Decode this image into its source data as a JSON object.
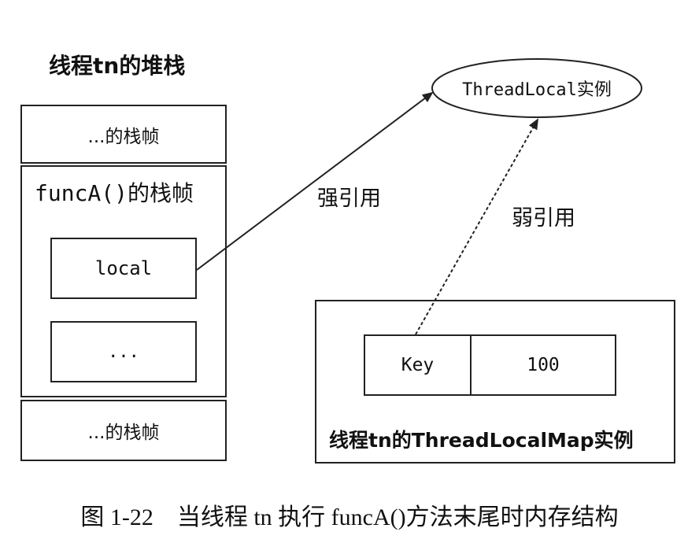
{
  "stack": {
    "title": "线程tn的堆栈",
    "top_frame_label": "...的栈帧",
    "funca_frame_title": "funcA()的栈帧",
    "local_label": "local",
    "dots_label": "...",
    "bottom_frame_label": "...的栈帧"
  },
  "thread_local": {
    "label": "ThreadLocal实例"
  },
  "arrows": {
    "strong_label": "强引用",
    "weak_label": "弱引用"
  },
  "map": {
    "key_label": "Key",
    "value_label": "100",
    "title": "线程tn的ThreadLocalMap实例"
  },
  "caption": "图 1-22　当线程 tn 执行 funcA()方法末尾时内存结构",
  "colors": {
    "line": "#222222",
    "background": "#ffffff"
  }
}
